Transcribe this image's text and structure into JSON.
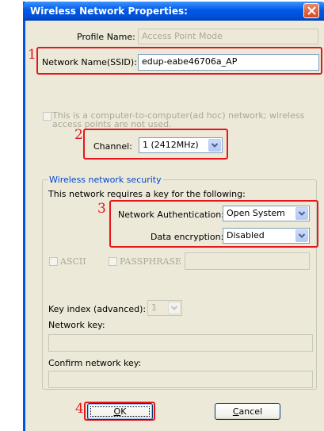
{
  "window": {
    "title": "Wireless Network Properties:",
    "close_icon": "close-icon",
    "colors": {
      "titlebar": "#0058e6",
      "highlight": "#e8151d",
      "group_label": "#0046d5"
    }
  },
  "profile": {
    "label": "Profile Name:",
    "value": "Access Point Mode"
  },
  "ssid": {
    "label": "Network Name(SSID):",
    "value": "edup-eabe46706a_AP"
  },
  "adhoc": {
    "text_line1": "This is a computer-to-computer(ad hoc) network; wireless",
    "text_line2": "access points are not used."
  },
  "channel": {
    "label": "Channel:",
    "value": "1  (2412MHz)"
  },
  "security": {
    "group_label": "Wireless network security",
    "requires_text": "This network requires a key for the following:",
    "auth_label": "Network Authentication:",
    "auth_value": "Open System",
    "encryption_label": "Data encryption:",
    "encryption_value": "Disabled",
    "ascii_label": "ASCII",
    "passphrase_label": "PASSPHRASE",
    "key_index_label": "Key index (advanced):",
    "key_index_value": "1",
    "network_key_label": "Network key:",
    "confirm_key_label": "Confirm network key:"
  },
  "buttons": {
    "ok_label_underlined": "O",
    "ok_label_rest": "K",
    "cancel_label_underlined": "C",
    "cancel_label_rest": "ancel"
  },
  "annotations": [
    "1",
    "2",
    "3",
    "4"
  ]
}
